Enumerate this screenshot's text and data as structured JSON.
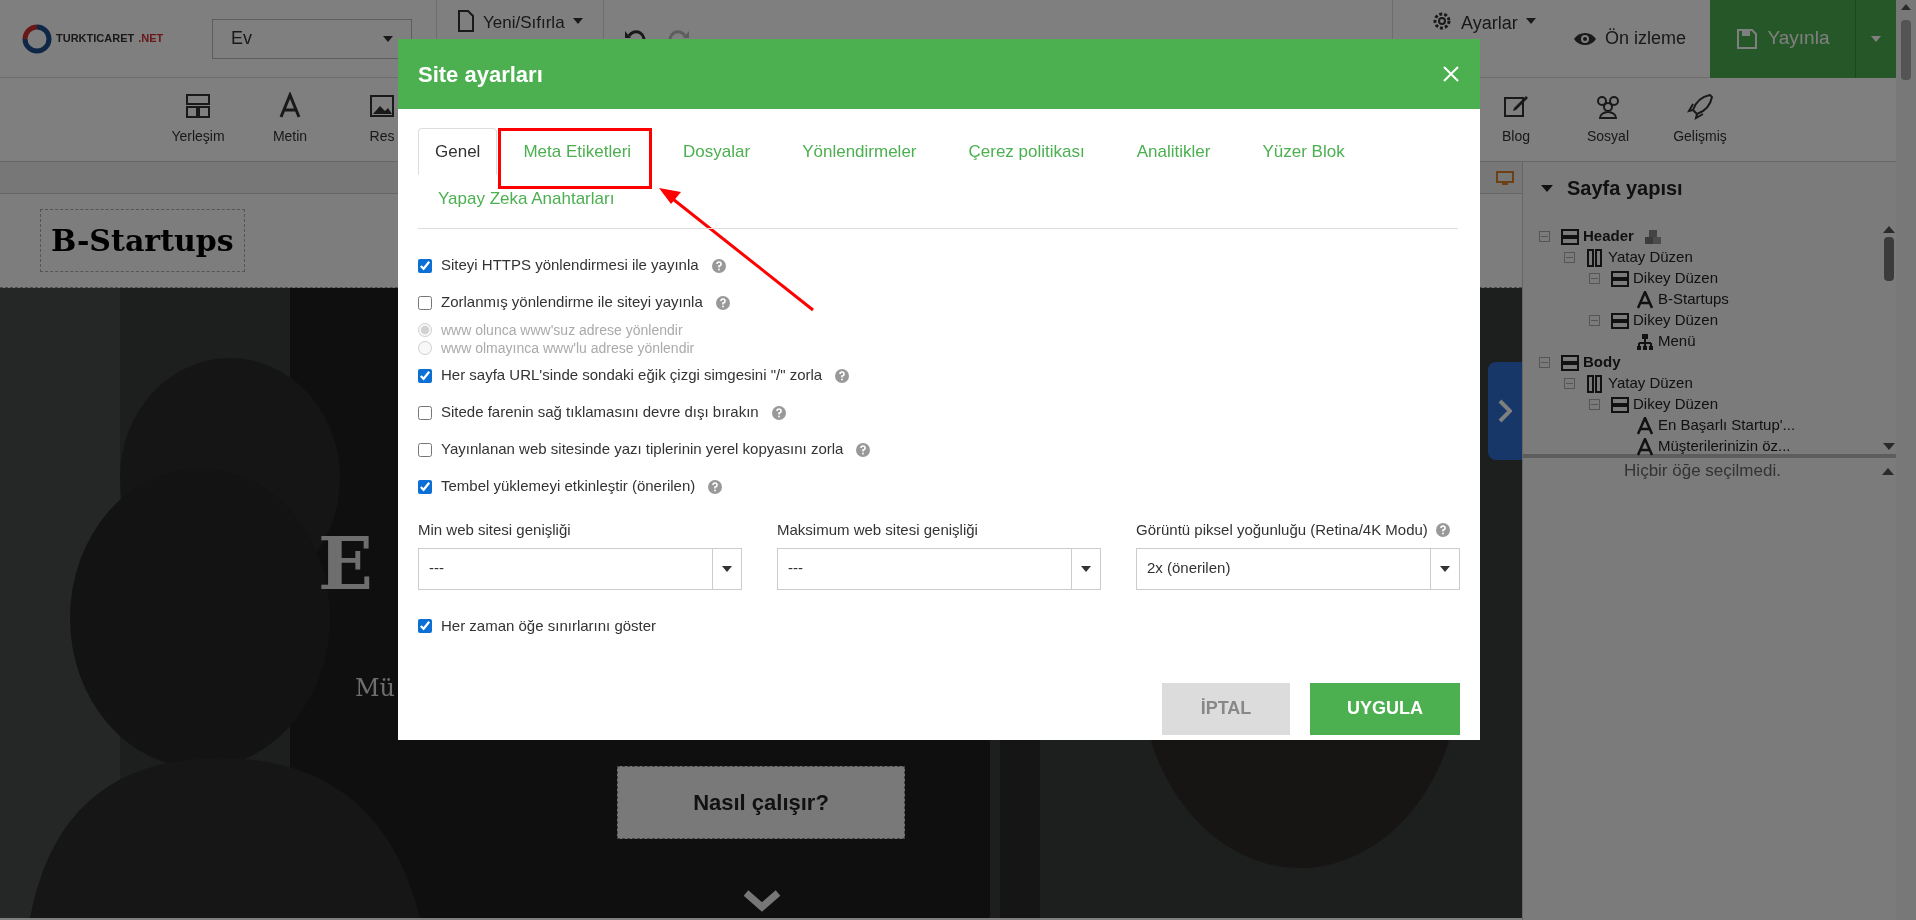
{
  "topbar": {
    "logo_main": "TURKTICARET",
    "logo_suffix": ".NET",
    "page_select": "Ev",
    "new_reset": "Yeni/Sıfırla",
    "settings": "Ayarlar",
    "preview": "Ön izleme",
    "publish": "Yayınla"
  },
  "toolbar": {
    "left": [
      "Yerleşim",
      "Metin",
      "Res"
    ],
    "right": [
      "Blog",
      "Sosyal",
      "Gelişmiş"
    ]
  },
  "canvas": {
    "logo": "B-Startups",
    "headline": "E",
    "subtitle": "Mü",
    "cta": "Nasıl çalışır?"
  },
  "page_structure": {
    "title": "Sayfa yapısı",
    "status": "Hiçbir öğe seçilmedi.",
    "tree": [
      {
        "label": "Header",
        "kind": "section",
        "shared": true,
        "expanded": true,
        "children": [
          {
            "label": "Yatay Düzen",
            "kind": "row",
            "expanded": true,
            "children": [
              {
                "label": "Dikey Düzen",
                "kind": "column",
                "expanded": true,
                "children": [
                  {
                    "label": "B-Startups",
                    "kind": "text"
                  }
                ]
              },
              {
                "label": "Dikey Düzen",
                "kind": "column",
                "expanded": true,
                "children": [
                  {
                    "label": "Menü",
                    "kind": "menu"
                  }
                ]
              }
            ]
          }
        ]
      },
      {
        "label": "Body",
        "kind": "section",
        "shared": false,
        "expanded": true,
        "children": [
          {
            "label": "Yatay Düzen",
            "kind": "row",
            "expanded": true,
            "children": [
              {
                "label": "Dikey Düzen",
                "kind": "column",
                "expanded": true,
                "children": [
                  {
                    "label": "En Başarlı Startup'...",
                    "kind": "text"
                  },
                  {
                    "label": "Müşterilerinizin öz...",
                    "kind": "text"
                  }
                ]
              }
            ]
          }
        ]
      }
    ]
  },
  "dialog": {
    "title": "Site ayarları",
    "tabs": [
      {
        "label": "Genel",
        "selected": true
      },
      {
        "label": "Meta Etiketleri",
        "selected": false
      },
      {
        "label": "Dosyalar",
        "selected": false
      },
      {
        "label": "Yönlendirmeler",
        "selected": false
      },
      {
        "label": "Çerez politikası",
        "selected": false
      },
      {
        "label": "Analitikler",
        "selected": false
      },
      {
        "label": "Yüzer Blok",
        "selected": false
      },
      {
        "label": "Yapay Zeka Anahtarları",
        "selected": false
      }
    ],
    "options": [
      {
        "kind": "checkbox",
        "label": "Siteyi HTTPS yönlendirmesi ile yayınla",
        "checked": true,
        "help": true
      },
      {
        "kind": "checkbox",
        "label": "Zorlanmış yönlendirme ile siteyi yayınla",
        "checked": false,
        "help": true
      },
      {
        "kind": "radio",
        "label": "www olunca www'suz adrese yönlendir",
        "selected": true,
        "disabled": true
      },
      {
        "kind": "radio",
        "label": "www olmayınca www'lu adrese yönlendir",
        "selected": false,
        "disabled": true
      },
      {
        "kind": "checkbox",
        "label": "Her sayfa URL'sinde sondaki eğik çizgi simgesini \"/\" zorla",
        "checked": true,
        "help": true
      },
      {
        "kind": "checkbox",
        "label": "Sitede farenin sağ tıklamasını devre dışı bırakın",
        "checked": false,
        "help": true
      },
      {
        "kind": "checkbox",
        "label": "Yayınlanan web sitesinde yazı tiplerinin yerel kopyasını zorla",
        "checked": false,
        "help": true
      },
      {
        "kind": "checkbox",
        "label": "Tembel yüklemeyi etkinleştir (önerilen)",
        "checked": true,
        "help": true
      }
    ],
    "selects": [
      {
        "label": "Min web sitesi genişliği",
        "value": "---",
        "help": false
      },
      {
        "label": "Maksimum web sitesi genişliği",
        "value": "---",
        "help": false
      },
      {
        "label": "Görüntü piksel yoğunluğu (Retina/4K Modu)",
        "value": "2x (önerilen)",
        "help": true
      }
    ],
    "final_option": {
      "label": "Her zaman öğe sınırlarını göster",
      "checked": true
    },
    "cancel": "İPTAL",
    "apply": "UYGULA"
  }
}
